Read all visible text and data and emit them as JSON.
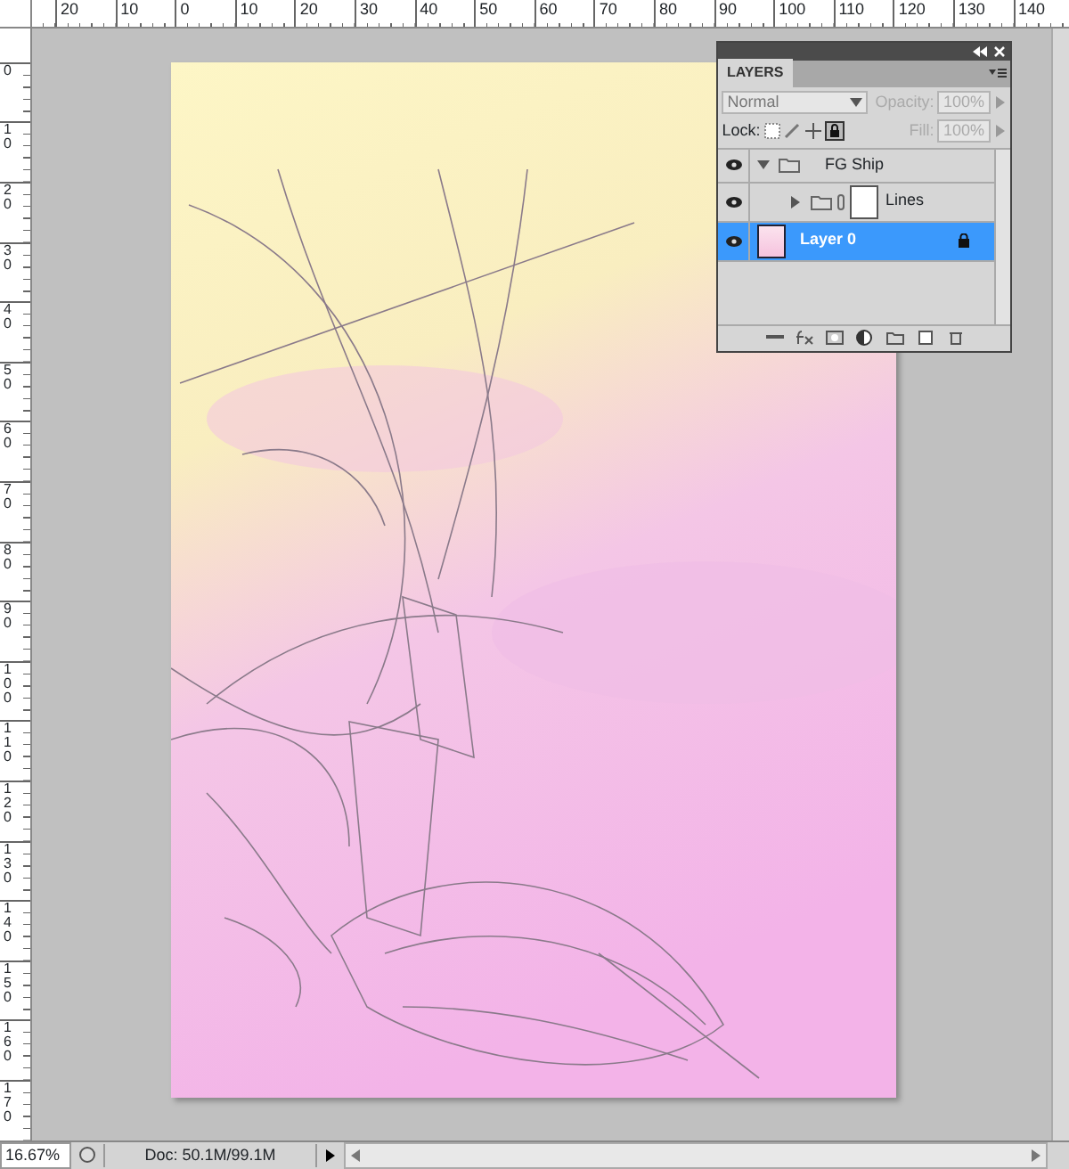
{
  "rulers": {
    "horizontal": [
      "20",
      "10",
      "0",
      "10",
      "20",
      "30",
      "40",
      "50",
      "60",
      "70",
      "80",
      "90",
      "100",
      "110",
      "120",
      "130",
      "140"
    ],
    "vertical": [
      "0",
      "10",
      "20",
      "30",
      "40",
      "50",
      "60",
      "70",
      "80",
      "90",
      "100",
      "110",
      "120",
      "130",
      "140",
      "150",
      "160",
      "170"
    ]
  },
  "layers_panel": {
    "tab": "LAYERS",
    "blend_mode": "Normal",
    "opacity_label": "Opacity:",
    "opacity": "100%",
    "lock_label": "Lock:",
    "fill_label": "Fill:",
    "fill": "100%",
    "fields_disabled": true,
    "layers": [
      {
        "name": "FG Ship",
        "kind": "group",
        "visible": true,
        "expanded": true,
        "selected": false,
        "children": [
          {
            "name": "Lines",
            "kind": "group",
            "visible": true,
            "expanded": false,
            "selected": false
          }
        ]
      },
      {
        "name": "Layer 0",
        "kind": "layer",
        "visible": true,
        "selected": true,
        "locked": true
      }
    ]
  },
  "status_bar": {
    "zoom": "16.67%",
    "doc_info": "Doc: 50.1M/99.1M"
  }
}
